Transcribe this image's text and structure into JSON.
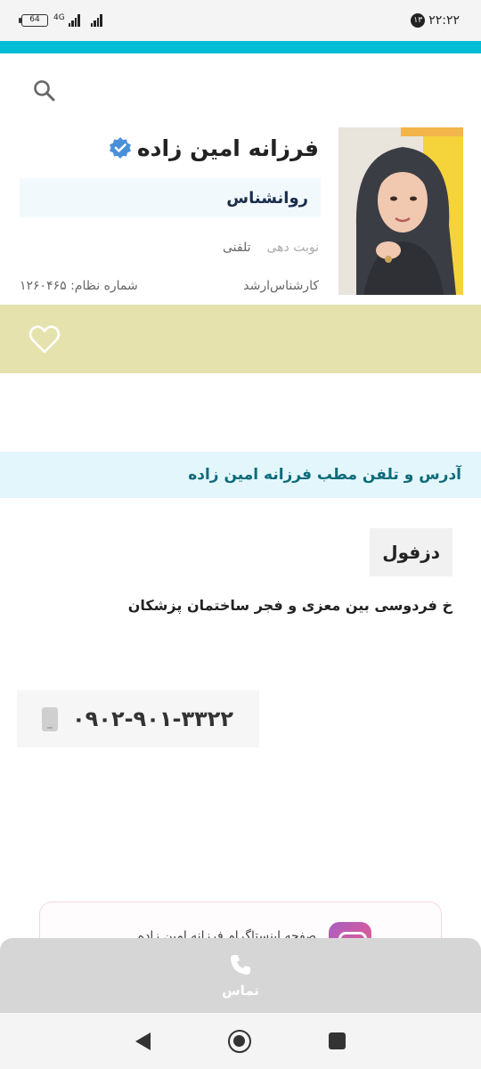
{
  "status_bar": {
    "time": "۲۲:۲۲",
    "notification_count": "۱۳",
    "battery": "64",
    "network": "4G"
  },
  "profile": {
    "name": "فرزانه امین زاده",
    "verified": true,
    "specialty": "روانشناس",
    "booking_label": "نوبت دهی",
    "booking_type": "تلفنی",
    "degree": "کارشناس‌ارشد",
    "license_label": "شماره نظام:",
    "license_number": "۱۲۶۰۴۶۵"
  },
  "address_section": {
    "title": "آدرس و تلفن مطب فرزانه امین زاده",
    "city": "دزفول",
    "address": "خ فردوسی بین معزی و فجر ساختمان پزشکان",
    "phone": "۰۹۰۲-۹۰۱-۳۳۲۲"
  },
  "social": {
    "text": "صفحه اینستاگرام فرزانه امین زاده"
  },
  "call_bar": {
    "label": "تماس"
  },
  "colors": {
    "accent_teal": "#00bcd4",
    "fav_band": "#e6e2ae",
    "header_bg": "#e3f6fb",
    "verified_blue": "#4a90d9"
  },
  "icons": [
    "search-icon",
    "verified-icon",
    "heart-icon",
    "phone-icon",
    "instagram-icon",
    "call-icon",
    "back-icon",
    "home-icon",
    "recents-icon"
  ]
}
